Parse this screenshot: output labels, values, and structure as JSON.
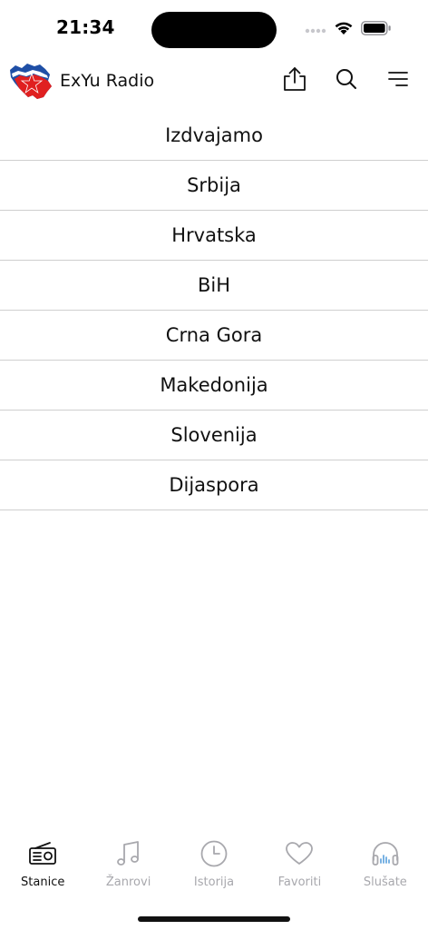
{
  "status_bar": {
    "time": "21:34"
  },
  "header": {
    "title": "ExYu Radio",
    "logo_icon": "yugoslavia-map-logo-icon",
    "actions": [
      {
        "name": "share",
        "icon": "share-icon"
      },
      {
        "name": "search",
        "icon": "search-icon"
      },
      {
        "name": "menu",
        "icon": "menu-icon"
      }
    ]
  },
  "regions": [
    {
      "label": "Izdvajamo"
    },
    {
      "label": "Srbija"
    },
    {
      "label": "Hrvatska"
    },
    {
      "label": "BiH"
    },
    {
      "label": "Crna Gora"
    },
    {
      "label": "Makedonija"
    },
    {
      "label": "Slovenija"
    },
    {
      "label": "Dijaspora"
    }
  ],
  "tabs": [
    {
      "label": "Stanice",
      "icon": "radio-icon",
      "active": true
    },
    {
      "label": "Žanrovi",
      "icon": "music-note-icon",
      "active": false
    },
    {
      "label": "Istorija",
      "icon": "clock-icon",
      "active": false
    },
    {
      "label": "Favoriti",
      "icon": "heart-icon",
      "active": false
    },
    {
      "label": "Slušate",
      "icon": "headphones-icon",
      "active": false
    }
  ],
  "colors": {
    "active_tab": "#111111",
    "inactive_tab": "#a8a8ad",
    "divider": "#cfcfcf",
    "flag_blue": "#1f4fa6",
    "flag_red": "#e02020"
  }
}
